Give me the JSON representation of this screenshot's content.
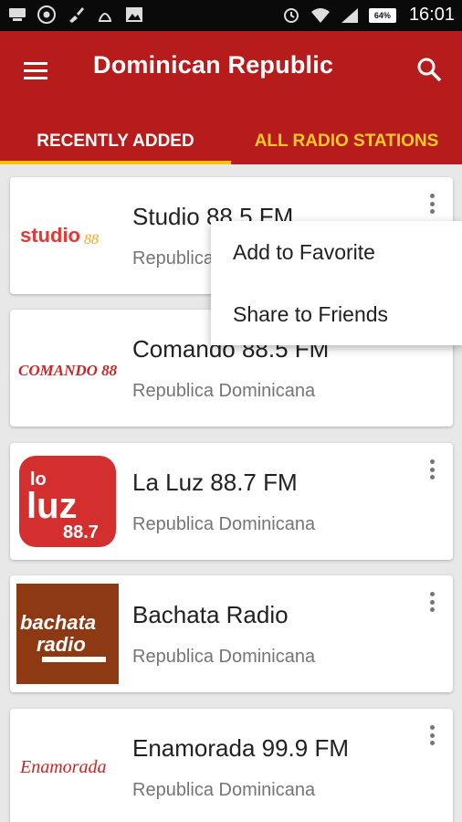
{
  "status_bar": {
    "time": "16:01",
    "battery": "64%",
    "left_icons": [
      "keyboard-icon",
      "chrome-icon",
      "paint-brush-icon",
      "signal-app-icon",
      "image-icon"
    ],
    "right_icons": [
      "sync-icon",
      "wifi-icon",
      "cell-signal-icon"
    ]
  },
  "app_bar": {
    "title": "Dominican Republic",
    "menu_icon": "menu-icon",
    "search_icon": "search-icon",
    "background_color": "#b71c1c",
    "accent_color": "#ffc107"
  },
  "tabs": [
    {
      "label": "RECENTLY ADDED",
      "active": true
    },
    {
      "label": "ALL RADIO STATIONS",
      "active": false
    }
  ],
  "stations": [
    {
      "name": "Studio 88.5 FM",
      "country": "Republica Dominicana",
      "logo_text": "studio88"
    },
    {
      "name": "Comando 88.5 FM",
      "country": "Republica Dominicana",
      "logo_text": "COMANDO 88"
    },
    {
      "name": "La Luz 88.7 FM",
      "country": "Republica Dominicana",
      "logo_text": "lo luz 88.7"
    },
    {
      "name": "Bachata Radio",
      "country": "Republica Dominicana",
      "logo_text": "bachata radio"
    },
    {
      "name": "Enamorada 99.9 FM",
      "country": "Republica Dominicana",
      "logo_text": "Enamorada"
    }
  ],
  "popup_menu": {
    "items": [
      "Add to Favorite",
      "Share to Friends"
    ]
  }
}
